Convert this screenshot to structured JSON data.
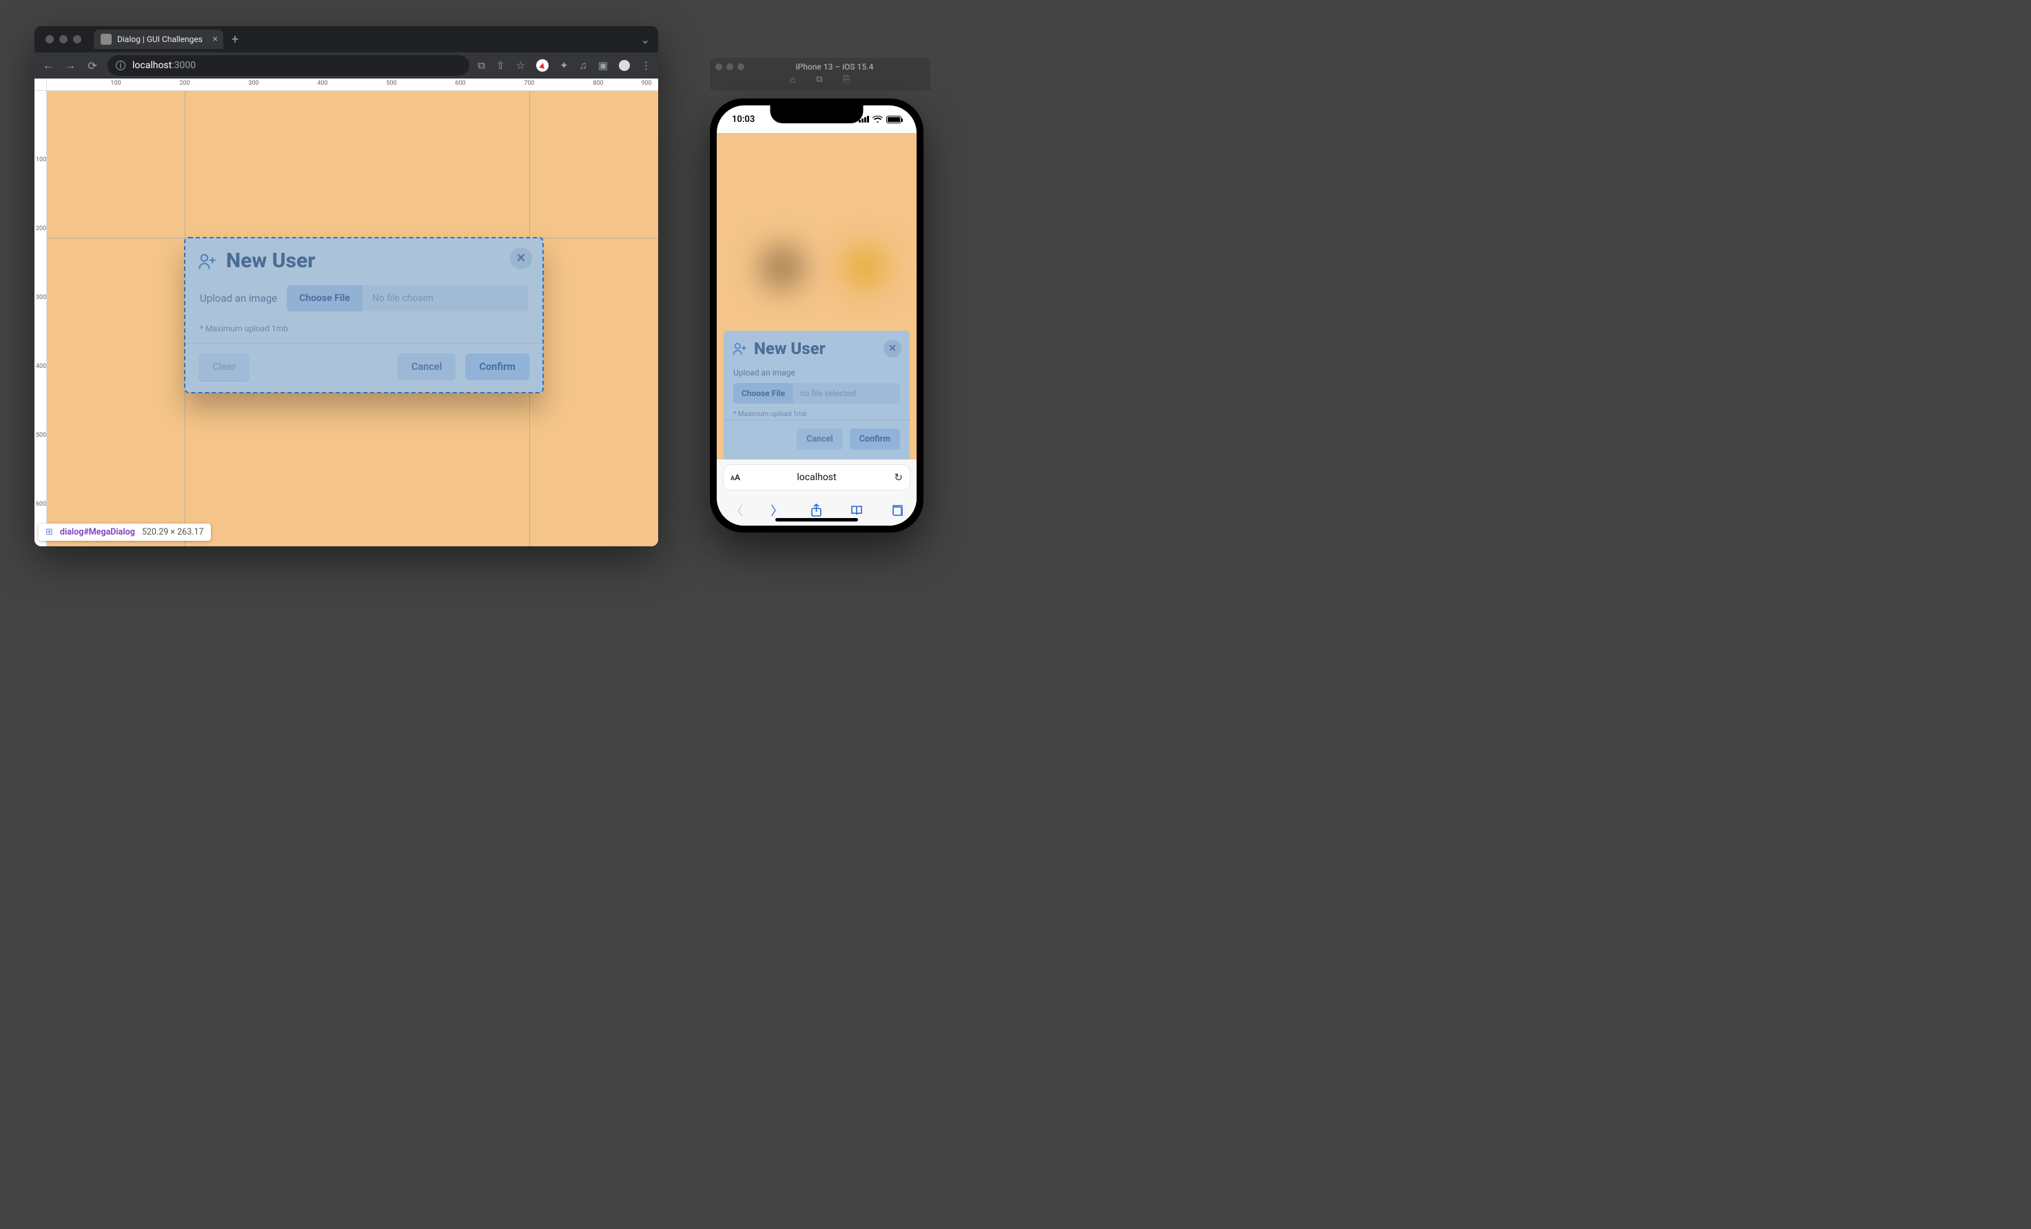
{
  "browser": {
    "tab_title": "Dialog | GUI Challenges",
    "url_host": "localhost",
    "url_port": ":3000",
    "ruler_h": [
      "100",
      "200",
      "300",
      "400",
      "500",
      "600",
      "700",
      "800",
      "900"
    ],
    "ruler_v": [
      "100",
      "200",
      "300",
      "400",
      "500",
      "600"
    ]
  },
  "dialog": {
    "title": "New User",
    "upload_label": "Upload an image",
    "choose_file": "Choose File",
    "no_file": "No file chosen",
    "hint": "* Maximum upload 1mb",
    "clear": "Clear",
    "cancel": "Cancel",
    "confirm": "Confirm"
  },
  "inspect": {
    "selector": "dialog#MegaDialog",
    "dims": "520.29 × 263.17"
  },
  "simulator": {
    "title": "iPhone 13 – iOS 15.4",
    "status_time": "10:03",
    "safari_host": "localhost"
  },
  "dialog_mobile": {
    "title": "New User",
    "upload_label": "Upload an image",
    "choose_file": "Choose File",
    "no_file": "no file selected",
    "hint": "* Maximum upload 1mb",
    "cancel": "Cancel",
    "confirm": "Confirm"
  }
}
